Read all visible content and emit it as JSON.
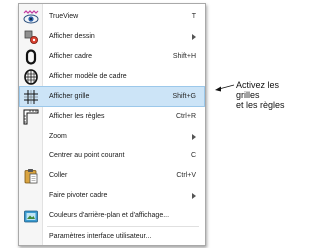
{
  "menu": {
    "items": [
      {
        "label": "TrueView",
        "shortcut": "T",
        "icon": "trueview-eye-icon"
      },
      {
        "label": "Afficher dessin",
        "submenu": true,
        "icon": "design-gear-icon"
      },
      {
        "label": "Afficher cadre",
        "shortcut": "Shift+H",
        "icon": "hoop-frame-icon"
      },
      {
        "label": "Afficher modèle de cadre",
        "icon": "hoop-template-icon"
      },
      {
        "label": "Afficher grille",
        "shortcut": "Shift+G",
        "icon": "grid-icon",
        "highlighted": true
      },
      {
        "label": "Afficher les règles",
        "shortcut": "Ctrl+R",
        "icon": "rulers-icon"
      },
      {
        "label": "Zoom",
        "submenu": true
      },
      {
        "label": "Centrer au point courant",
        "shortcut": "C"
      },
      {
        "label": "Coller",
        "shortcut": "Ctrl+V",
        "icon": "paste-clipboard-icon"
      },
      {
        "label": "Faire pivoter cadre",
        "submenu": true
      },
      {
        "label": "Couleurs d'arrière-plan et d'affichage...",
        "icon": "background-colors-icon"
      },
      {
        "label": "Paramètres interface utilisateur..."
      }
    ]
  },
  "callout": {
    "line1": "Activez les grilles",
    "line2": "et les règles"
  },
  "colors": {
    "highlight": "#cce4f7",
    "highlight_border": "#9cc8ea",
    "menu_border": "#a9a9a9"
  }
}
